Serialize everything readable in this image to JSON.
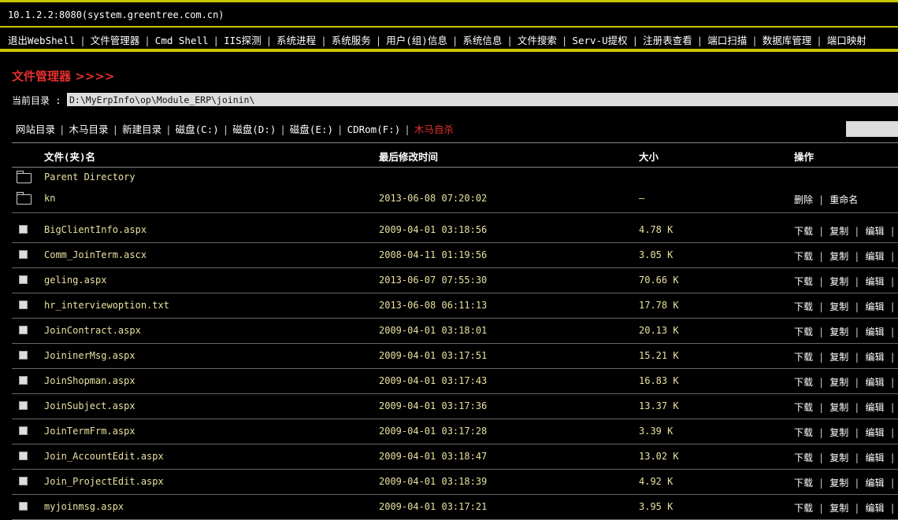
{
  "host": "10.1.2.2:8080(system.greentree.com.cn)",
  "menu": [
    "退出WebShell",
    "文件管理器",
    "Cmd Shell",
    "IIS探测",
    "系统进程",
    "系统服务",
    "用户(组)信息",
    "系统信息",
    "文件搜索",
    "Serv-U提权",
    "注册表查看",
    "端口扫描",
    "数据库管理",
    "端口映射"
  ],
  "menu_separator": "|",
  "page_title": "文件管理器 >>>>",
  "current_dir": {
    "label": "当前目录 :",
    "value": "D:\\MyErpInfo\\op\\Module_ERP\\joinin\\"
  },
  "quick_links": [
    {
      "label": "网站目录",
      "danger": false
    },
    {
      "label": "木马目录",
      "danger": false
    },
    {
      "label": "新建目录",
      "danger": false
    },
    {
      "label": "磁盘(C:)",
      "danger": false
    },
    {
      "label": "磁盘(D:)",
      "danger": false
    },
    {
      "label": "磁盘(E:)",
      "danger": false
    },
    {
      "label": "CDRom(F:)",
      "danger": false
    },
    {
      "label": "木马自杀",
      "danger": true
    }
  ],
  "table": {
    "headers": {
      "name": "文件(夹)名",
      "time": "最后修改时间",
      "size": "大小",
      "ops": "操作"
    },
    "directories": [
      {
        "name": "Parent Directory",
        "time": "",
        "size": "",
        "ops": []
      },
      {
        "name": "kn",
        "time": "2013-06-08 07:20:02",
        "size": "—",
        "ops": [
          "删除",
          "重命名"
        ]
      }
    ],
    "files": [
      {
        "name": "BigClientInfo.aspx",
        "time": "2009-04-01 03:18:56",
        "size": "4.78 K"
      },
      {
        "name": "Comm_JoinTerm.ascx",
        "time": "2008-04-11 01:19:56",
        "size": "3.05 K"
      },
      {
        "name": "geling.aspx",
        "time": "2013-06-07 07:55:30",
        "size": "70.66 K"
      },
      {
        "name": "hr_interviewoption.txt",
        "time": "2013-06-08 06:11:13",
        "size": "17.78 K"
      },
      {
        "name": "JoinContract.aspx",
        "time": "2009-04-01 03:18:01",
        "size": "20.13 K"
      },
      {
        "name": "JoininerMsg.aspx",
        "time": "2009-04-01 03:17:51",
        "size": "15.21 K"
      },
      {
        "name": "JoinShopman.aspx",
        "time": "2009-04-01 03:17:43",
        "size": "16.83 K"
      },
      {
        "name": "JoinSubject.aspx",
        "time": "2009-04-01 03:17:36",
        "size": "13.37 K"
      },
      {
        "name": "JoinTermFrm.aspx",
        "time": "2009-04-01 03:17:28",
        "size": "3.39 K"
      },
      {
        "name": "Join_AccountEdit.aspx",
        "time": "2009-04-01 03:18:47",
        "size": "13.02 K"
      },
      {
        "name": "Join_ProjectEdit.aspx",
        "time": "2009-04-01 03:18:39",
        "size": "4.92 K"
      },
      {
        "name": "myjoinmsg.aspx",
        "time": "2009-04-01 03:17:21",
        "size": "3.95 K"
      }
    ],
    "file_ops": [
      "下载",
      "复制",
      "编辑"
    ]
  },
  "colors": {
    "accent": "#c8c400",
    "danger": "#e53030",
    "text_value": "#e8e0a0"
  }
}
